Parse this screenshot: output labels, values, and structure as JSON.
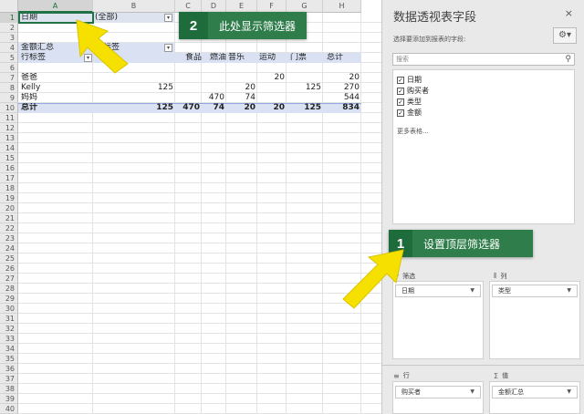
{
  "sheet": {
    "columns": [
      "A",
      "B",
      "C",
      "D",
      "E",
      "F",
      "G",
      "H"
    ],
    "rows": [
      "1",
      "2",
      "3",
      "4",
      "5",
      "6",
      "7",
      "8",
      "9",
      "10",
      "11",
      "12",
      "13",
      "14",
      "15",
      "16",
      "17",
      "18",
      "19",
      "20",
      "21",
      "22",
      "23",
      "24",
      "25",
      "26",
      "27",
      "28",
      "29",
      "30",
      "31",
      "32",
      "33",
      "34",
      "35",
      "36",
      "37",
      "38",
      "39",
      "40"
    ],
    "filter_label": "日期",
    "filter_value": "(全部)",
    "sum_label": "金额汇总",
    "row_label": "行标签",
    "col_label": "列标签",
    "col_headers": [
      "食品",
      "燃油",
      "音乐",
      "运动",
      "门票",
      "总计"
    ],
    "data_rows": [
      {
        "label": "爸爸",
        "values": [
          "",
          "",
          "",
          "20",
          "",
          "20"
        ]
      },
      {
        "label": "Kelly",
        "values": [
          "125",
          "",
          "20",
          "",
          "125",
          "270"
        ]
      },
      {
        "label": "妈妈",
        "values": [
          "",
          "470",
          "74",
          "",
          "",
          "544"
        ]
      }
    ],
    "total_row": {
      "label": "总计",
      "values": [
        "125",
        "470",
        "74",
        "20",
        "20",
        "125",
        "834"
      ]
    }
  },
  "callouts": [
    {
      "number": "2",
      "text": "此处显示筛选器"
    },
    {
      "number": "1",
      "text": "设置顶层筛选器"
    }
  ],
  "panel": {
    "title": "数据透视表字段",
    "close": "×",
    "subtitle": "选择要添加到报表的字段:",
    "gear": "⚙▾",
    "search_placeholder": "搜索",
    "fields": [
      {
        "label": "日期",
        "checked": "✓"
      },
      {
        "label": "购买者",
        "checked": "✓"
      },
      {
        "label": "类型",
        "checked": "✓"
      },
      {
        "label": "金额",
        "checked": "✓"
      }
    ],
    "more_tables": "更多表格...",
    "areas": {
      "filter": {
        "label": "筛选",
        "item": "日期"
      },
      "columns": {
        "label": "列",
        "item": "类型"
      },
      "rows": {
        "label": "行",
        "item": "购买者"
      },
      "values": {
        "label": "值",
        "item": "金额汇总"
      }
    }
  },
  "colors": {
    "accent": "#217346",
    "callout": "#2e7d4a",
    "pivot_band": "#d9e1f2",
    "arrow": "#f5e000"
  }
}
